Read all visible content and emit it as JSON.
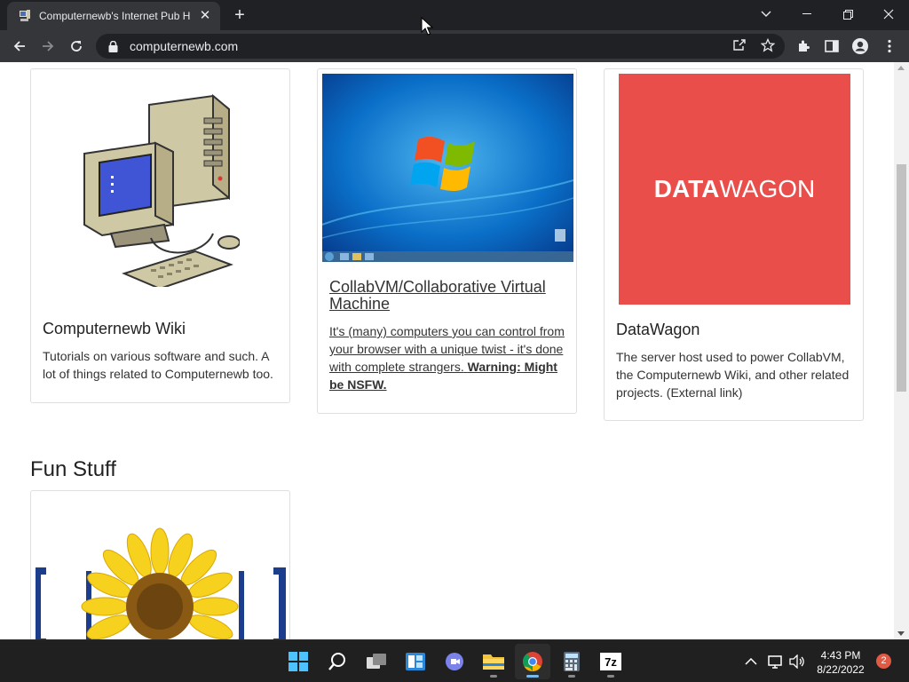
{
  "browser": {
    "tab_title": "Computernewb's Internet Pub Hub",
    "url": "computernewb.com"
  },
  "cards": [
    {
      "title": "Computernewb Wiki",
      "text": "Tutorials on various software and such. A lot of things related to Computernewb too."
    },
    {
      "title": "CollabVM/Collaborative Virtual Machine",
      "text": "It's (many) computers you can control from your browser with a unique twist - it's done with complete strangers.",
      "warning": "Warning: Might be NSFW."
    },
    {
      "title": "DataWagon",
      "text": "The server host used to power CollabVM, the Computernewb Wiki, and other related projects. (External link)",
      "logo_bold": "DATA",
      "logo_light": "WAGON",
      "logo_color": "#e94e4a"
    }
  ],
  "section": {
    "fun_stuff_heading": "Fun Stuff"
  },
  "taskbar": {
    "time": "4:43 PM",
    "date": "8/22/2022",
    "notifications": "2",
    "apps": [
      "start-icon",
      "search-icon",
      "task-view-icon",
      "widgets-icon",
      "chat-icon",
      "file-explorer-icon",
      "chrome-icon",
      "calculator-icon",
      "7zip-icon"
    ]
  }
}
